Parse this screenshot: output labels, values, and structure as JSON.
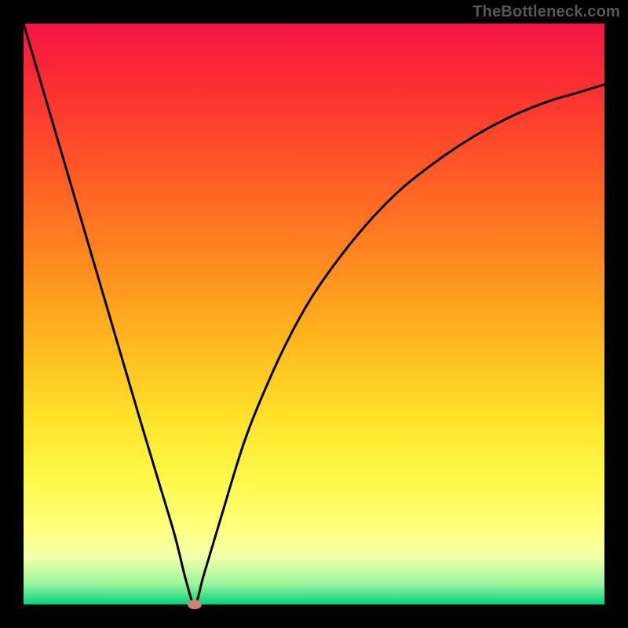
{
  "watermark": "TheBottleneck.com",
  "chart_data": {
    "type": "line",
    "title": "",
    "xlabel": "",
    "ylabel": "",
    "xlim": [
      0,
      1
    ],
    "ylim": [
      0,
      1
    ],
    "series": [
      {
        "name": "curve",
        "x": [
          0.0,
          0.05,
          0.1,
          0.15,
          0.2,
          0.23,
          0.26,
          0.28,
          0.295,
          0.31,
          0.34,
          0.38,
          0.42,
          0.46,
          0.5,
          0.55,
          0.6,
          0.65,
          0.7,
          0.75,
          0.8,
          0.85,
          0.9,
          0.95,
          1.0
        ],
        "y": [
          1.0,
          0.83,
          0.66,
          0.49,
          0.32,
          0.22,
          0.12,
          0.04,
          0.0,
          0.05,
          0.15,
          0.28,
          0.38,
          0.465,
          0.535,
          0.605,
          0.665,
          0.715,
          0.755,
          0.79,
          0.82,
          0.845,
          0.865,
          0.88,
          0.895
        ]
      }
    ],
    "marker": {
      "x": 0.295,
      "y": 0.0
    },
    "background_gradient": {
      "top": "#f31645",
      "bottom": "#02d37f"
    }
  }
}
